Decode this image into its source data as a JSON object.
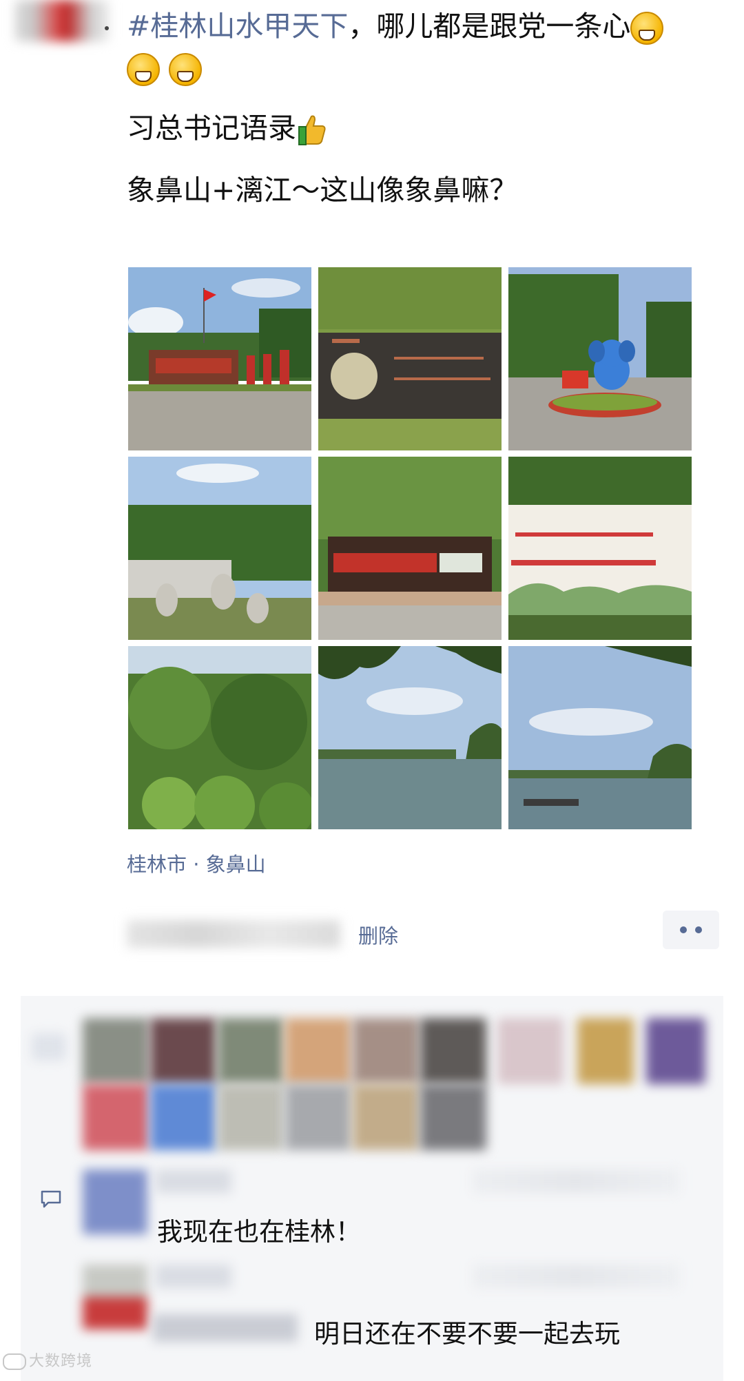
{
  "post": {
    "line1_tag": "#桂林山水甲天下",
    "line1_rest": "，哪儿都是跟党一条心",
    "line2": "习总书记语录",
    "line3": "象鼻山+漓江～这山像象鼻嘛？"
  },
  "location": "桂林市 · 象鼻山",
  "actions": {
    "delete_label": "删除"
  },
  "comments": [
    {
      "text": "我现在也在桂林！"
    },
    {
      "text": "明日还在不要不要一起去玩"
    }
  ],
  "photos": [
    {
      "icon": "park-entrance-photo"
    },
    {
      "icon": "stone-plaque-photo"
    },
    {
      "icon": "elephant-statue-photo"
    },
    {
      "icon": "stone-sculptures-photo"
    },
    {
      "icon": "notice-board-photo"
    },
    {
      "icon": "red-banner-photo"
    },
    {
      "icon": "green-foliage-photo"
    },
    {
      "icon": "river-view-photo"
    },
    {
      "icon": "river-boat-photo"
    }
  ],
  "watermark": "大数跨境",
  "colors": {
    "link": "#576b95",
    "panel": "#f5f6f8"
  }
}
